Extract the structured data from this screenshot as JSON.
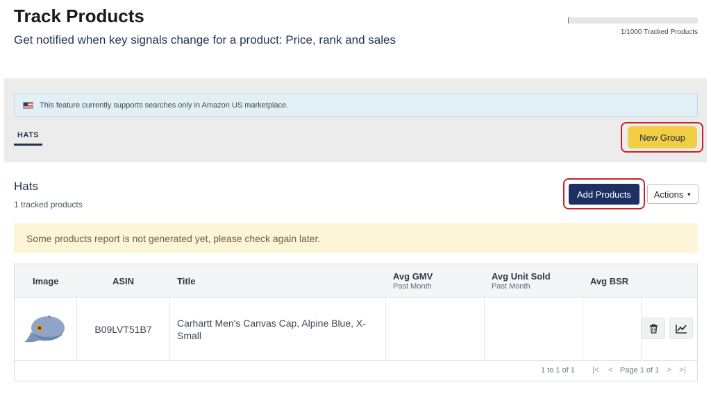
{
  "header": {
    "title": "Track Products",
    "subtitle": "Get notified when key signals change for a product: Price, rank and sales",
    "quota_text": "1/1000 Tracked Products",
    "quota_fraction": 0.001
  },
  "notice": {
    "text": "This feature currently supports searches only in Amazon US marketplace.",
    "flag_icon": "us-flag-icon"
  },
  "tabs": [
    {
      "label": "HATS",
      "active": true
    }
  ],
  "buttons": {
    "new_group": "New Group",
    "add_products": "Add Products",
    "actions": "Actions"
  },
  "group": {
    "name": "Hats",
    "count": "1 tracked products"
  },
  "warning": {
    "text": "Some products report is not generated yet, please check again later."
  },
  "table": {
    "columns": {
      "image": "Image",
      "asin": "ASIN",
      "title": "Title",
      "avg_gmv": "Avg GMV",
      "avg_gmv_sub": "Past Month",
      "avg_unit_sold": "Avg Unit Sold",
      "avg_unit_sold_sub": "Past Month",
      "avg_bsr": "Avg BSR"
    },
    "rows": [
      {
        "asin": "B09LVT51B7",
        "title": "Carhartt Men's Canvas Cap, Alpine Blue, X-Small",
        "avg_gmv": "",
        "avg_unit_sold": "",
        "avg_bsr": ""
      }
    ],
    "pagination": {
      "range": "1 to 1 of 1",
      "page": "Page 1 of 1"
    }
  },
  "colors": {
    "primary": "#1e3062",
    "accent_yellow": "#f2ce45",
    "highlight_red": "#cc2127",
    "warning_bg": "#fdf5d8",
    "notice_bg": "#e2eff4"
  }
}
